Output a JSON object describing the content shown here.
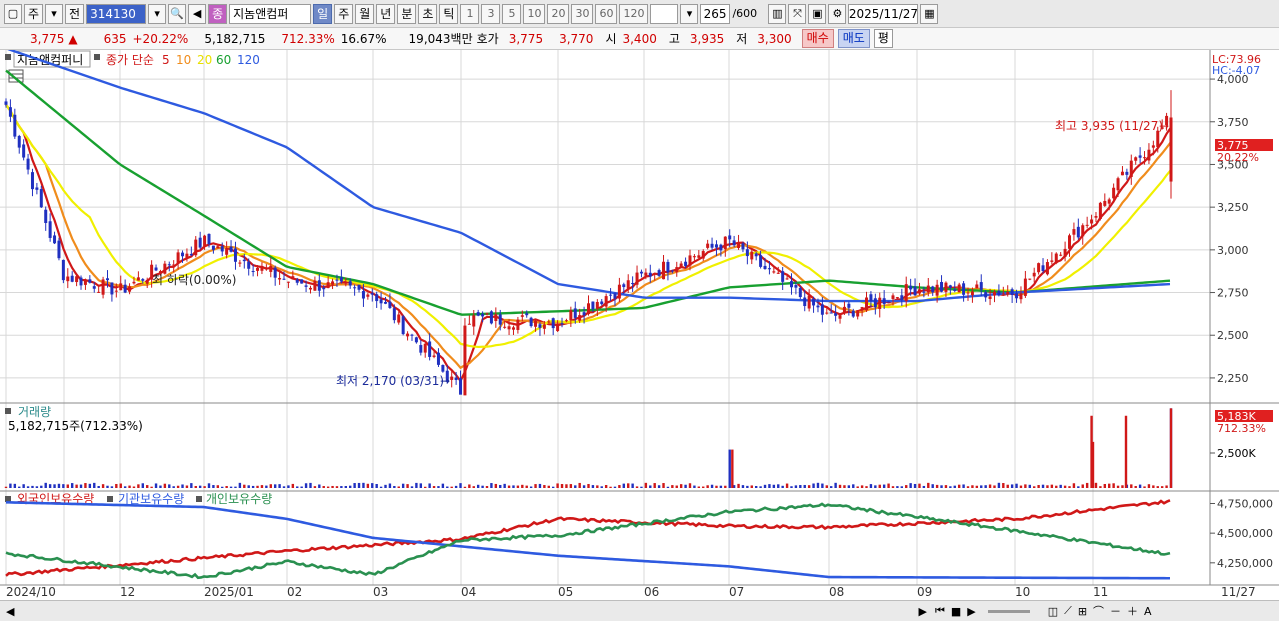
{
  "toolbar": {
    "period_type": "주",
    "prev_label": "전",
    "stock_code": "314130",
    "stock_name": "지놈앤컴퍼",
    "tag_label": "종",
    "timeframes": [
      "일",
      "주",
      "월",
      "년",
      "분",
      "초",
      "틱"
    ],
    "selected_timeframe": "일",
    "intervals": [
      "1",
      "3",
      "5",
      "10",
      "20",
      "30",
      "60",
      "120"
    ],
    "count_value": "265",
    "count_max": "/600",
    "date_value": "2025/11/27"
  },
  "info": {
    "price": "3,775",
    "change_arrow": "▲",
    "change": "635",
    "change_pct": "+20.22%",
    "volume": "5,182,715",
    "volume_pct": "712.33%",
    "turnover": "16.67%",
    "amount": "19,043백만",
    "quote_label": "호가",
    "ask": "3,775",
    "bid": "3,770",
    "open_label": "시",
    "open": "3,400",
    "high_label": "고",
    "high": "3,935",
    "low_label": "저",
    "low": "3,300",
    "buy_label": "매수",
    "sell_label": "매도",
    "avg_label": "평"
  },
  "price_panel": {
    "title": "지놈앤컴퍼니",
    "ma_label": "종가 단순",
    "ma_periods": [
      "5",
      "10",
      "20",
      "60",
      "120"
    ],
    "ma_colors": [
      "#d01818",
      "#f08c1c",
      "#f0f000",
      "#18a030",
      "#2e5ae0"
    ],
    "lc_label": "LC:73.96",
    "hc_label": "HC:-4.07",
    "current_label": "3,775",
    "current_pct_label": "20.22%",
    "max_annotation": "최고 3,935 (11/27)",
    "min_annotation": "최저 2,170 (03/31)",
    "mid_annotation": "최 하락(0.00%)",
    "y_ticks": [
      "4,000",
      "3,750",
      "3,500",
      "3,250",
      "3,000",
      "2,750",
      "2,500",
      "2,250"
    ]
  },
  "volume_panel": {
    "title": "거래량",
    "value_label": "5,182,715주(712.33%)",
    "current_label": "5,183K",
    "current_pct_label": "712.33%",
    "y_tick": "2,500K"
  },
  "holding_panel": {
    "series_labels": [
      "외국인보유수량",
      "기관보유수량",
      "개인보유수량"
    ],
    "series_colors": [
      "#d01818",
      "#2e5ae0",
      "#2a9050"
    ],
    "y_ticks": [
      "4,750,000",
      "4,500,000",
      "4,250,000"
    ]
  },
  "x_axis": {
    "labels": [
      "2024/10",
      "12",
      "2025/01",
      "02",
      "03",
      "04",
      "05",
      "06",
      "07",
      "08",
      "09",
      "10",
      "11"
    ],
    "current_label": "11/27"
  },
  "colors": {
    "up": "#d01818",
    "down": "#2030c0",
    "grid": "#d8d8d8",
    "axis_bg": "#ffffff"
  },
  "chart_data": {
    "type": "candlestick",
    "title": "지놈앤컴퍼니",
    "x_range": [
      "2024/10",
      "2025/11/27"
    ],
    "ylim": [
      2150,
      4100
    ],
    "price_anchors": [
      {
        "date": "2024/10",
        "close": 3850
      },
      {
        "date": "2024/11",
        "close": 2850
      },
      {
        "date": "2024/12",
        "close": 2760
      },
      {
        "date": "2025/01",
        "close": 3050
      },
      {
        "date": "2025/02",
        "close": 2820
      },
      {
        "date": "2025/03",
        "close": 2750
      },
      {
        "date": "2025/03/31",
        "close": 2170
      },
      {
        "date": "2025/04",
        "close": 2600
      },
      {
        "date": "2025/05",
        "close": 2580
      },
      {
        "date": "2025/06",
        "close": 2850
      },
      {
        "date": "2025/07",
        "close": 3050
      },
      {
        "date": "2025/08",
        "close": 2600
      },
      {
        "date": "2025/09",
        "close": 2780
      },
      {
        "date": "2025/10",
        "close": 2750
      },
      {
        "date": "2025/11",
        "close": 3200
      },
      {
        "date": "2025/11/27",
        "close": 3775
      }
    ],
    "ma120": [
      {
        "date": "2024/10",
        "value": 4180
      },
      {
        "date": "2024/12",
        "value": 3950
      },
      {
        "date": "2025/01",
        "value": 3800
      },
      {
        "date": "2025/02",
        "value": 3600
      },
      {
        "date": "2025/03",
        "value": 3250
      },
      {
        "date": "2025/04",
        "value": 3100
      },
      {
        "date": "2025/05",
        "value": 2800
      },
      {
        "date": "2025/06",
        "value": 2720
      },
      {
        "date": "2025/07",
        "value": 2720
      },
      {
        "date": "2025/08",
        "value": 2700
      },
      {
        "date": "2025/09",
        "value": 2700
      },
      {
        "date": "2025/10",
        "value": 2750
      },
      {
        "date": "2025/11/27",
        "value": 2800
      }
    ],
    "ma60": [
      {
        "date": "2024/10",
        "value": 4050
      },
      {
        "date": "2024/12",
        "value": 3500
      },
      {
        "date": "2025/01",
        "value": 3200
      },
      {
        "date": "2025/02",
        "value": 2900
      },
      {
        "date": "2025/03",
        "value": 2800
      },
      {
        "date": "2025/04",
        "value": 2620
      },
      {
        "date": "2025/05",
        "value": 2640
      },
      {
        "date": "2025/06",
        "value": 2660
      },
      {
        "date": "2025/07",
        "value": 2780
      },
      {
        "date": "2025/08",
        "value": 2820
      },
      {
        "date": "2025/09",
        "value": 2780
      },
      {
        "date": "2025/10",
        "value": 2750
      },
      {
        "date": "2025/11/27",
        "value": 2820
      }
    ],
    "max_point": {
      "date": "2025/11/27",
      "value": 3935
    },
    "min_point": {
      "date": "2025/03/31",
      "value": 2170
    },
    "volume": {
      "last": 5182715,
      "last_pct": 712.33,
      "spikes": [
        {
          "date": "2025/07",
          "value": 2500000
        },
        {
          "date": "2025/11",
          "value": 3000000
        },
        {
          "date": "2025/11",
          "value": 4700000
        },
        {
          "date": "2025/11/27",
          "value": 5182715
        }
      ]
    },
    "holdings": {
      "ylim": [
        4080000,
        4830000
      ],
      "series": [
        {
          "name": "외국인보유수량",
          "anchors": [
            {
              "date": "2024/10",
              "value": 4150000
            },
            {
              "date": "2025/02",
              "value": 4350000
            },
            {
              "date": "2025/04",
              "value": 4450000
            },
            {
              "date": "2025/05",
              "value": 4620000
            },
            {
              "date": "2025/07",
              "value": 4560000
            },
            {
              "date": "2025/08",
              "value": 4550000
            },
            {
              "date": "2025/10",
              "value": 4620000
            },
            {
              "date": "2025/11/27",
              "value": 4770000
            }
          ]
        },
        {
          "name": "기관보유수량",
          "anchors": [
            {
              "date": "2024/10",
              "value": 4760000
            },
            {
              "date": "2025/01",
              "value": 4720000
            },
            {
              "date": "2025/02",
              "value": 4620000
            },
            {
              "date": "2025/03",
              "value": 4460000
            },
            {
              "date": "2025/05",
              "value": 4310000
            },
            {
              "date": "2025/07",
              "value": 4220000
            },
            {
              "date": "2025/08",
              "value": 4130000
            },
            {
              "date": "2025/11/27",
              "value": 4120000
            }
          ]
        },
        {
          "name": "개인보유수량",
          "anchors": [
            {
              "date": "2024/10",
              "value": 4330000
            },
            {
              "date": "2025/01",
              "value": 4130000
            },
            {
              "date": "2025/02",
              "value": 4260000
            },
            {
              "date": "2025/03",
              "value": 4150000
            },
            {
              "date": "2025/04",
              "value": 4440000
            },
            {
              "date": "2025/05",
              "value": 4480000
            },
            {
              "date": "2025/07",
              "value": 4680000
            },
            {
              "date": "2025/08",
              "value": 4740000
            },
            {
              "date": "2025/10",
              "value": 4520000
            },
            {
              "date": "2025/11/27",
              "value": 4320000
            }
          ]
        }
      ]
    }
  }
}
